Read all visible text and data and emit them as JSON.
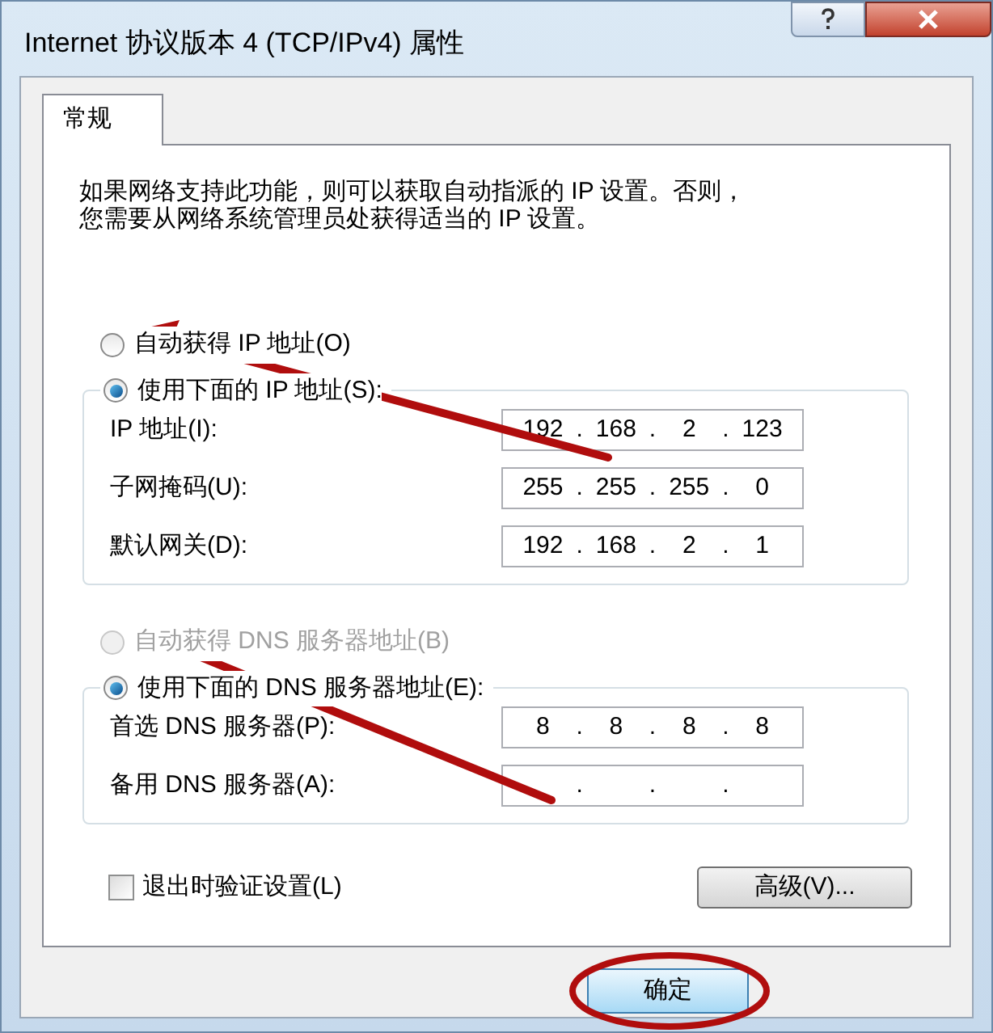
{
  "window": {
    "title": "Internet 协议版本 4 (TCP/IPv4) 属性"
  },
  "tabs": [
    {
      "label": "常规",
      "selected": true
    }
  ],
  "description": {
    "lines": [
      "如果网络支持此功能，则可以获取自动指派的 IP 设置。否则，",
      "您需要从网络系统管理员处获得适当的 IP 设置。"
    ]
  },
  "separator": ".",
  "ip_section": {
    "auto_option": {
      "label": "自动获得 IP 地址(O)",
      "selected": false,
      "disabled": false
    },
    "manual_option": {
      "label": "使用下面的 IP 地址(S):",
      "selected": true,
      "disabled": false
    },
    "fields": [
      {
        "label": "IP 地址(I):",
        "octets": [
          "192",
          "168",
          "2",
          "123"
        ]
      },
      {
        "label": "子网掩码(U):",
        "octets": [
          "255",
          "255",
          "255",
          "0"
        ]
      },
      {
        "label": "默认网关(D):",
        "octets": [
          "192",
          "168",
          "2",
          "1"
        ]
      }
    ]
  },
  "dns_section": {
    "auto_option": {
      "label": "自动获得 DNS 服务器地址(B)",
      "selected": false,
      "disabled": true
    },
    "manual_option": {
      "label": "使用下面的 DNS 服务器地址(E):",
      "selected": true,
      "disabled": false
    },
    "fields": [
      {
        "label": "首选 DNS 服务器(P):",
        "octets": [
          "8",
          "8",
          "8",
          "8"
        ]
      },
      {
        "label": "备用 DNS 服务器(A):"
      }
    ]
  },
  "validate_checkbox": {
    "label": "退出时验证设置(L)",
    "checked": false
  },
  "advanced_button": {
    "label": "高级(V)..."
  },
  "ok_button": {
    "label": "确定"
  }
}
